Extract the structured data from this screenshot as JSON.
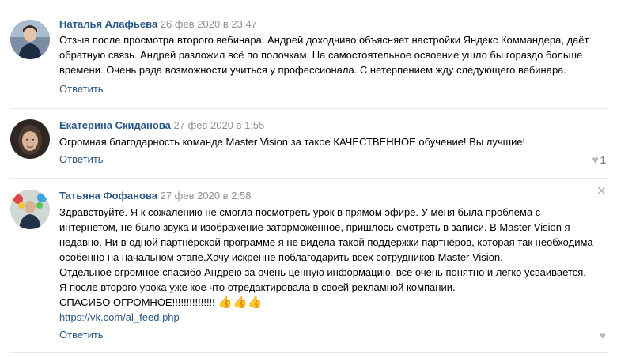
{
  "comments": [
    {
      "author": "Наталья Алафьева",
      "date": "26 фев 2020 в 23:47",
      "lines": [
        "Отзыв после просмотра второго вебинара. Андрей доходчиво объясняет настройки Яндекс Коммандера, даёт",
        "обратную связь. Андрей разложил всё по полочкам. На самостоятельное освоение ушло бы гораздо больше",
        "времени. Очень рада возможности учиться у профессионала. С нетерпением жду следующего вебинара."
      ],
      "reply_label": "Ответить"
    },
    {
      "author": "Екатерина Скиданова",
      "date": "27 фев 2020 в 1:55",
      "lines": [
        "Огромная благодарность команде Master Vision за такое КАЧЕСТВЕННОЕ обучение! Вы лучшие!"
      ],
      "reply_label": "Ответить",
      "likes": "1"
    },
    {
      "author": "Татьяна Фофанова",
      "date": "27 фев 2020 в 2:58",
      "lines": [
        "Здравствуйте. Я к сожалению не смогла посмотреть урок в прямом эфире. У меня была проблема с",
        "интернетом, не было звука и изображение заторможенное, пришлось смотреть в записи. В Master Vision я",
        "недавно. Ни в одной партнёрской программе я не видела такой поддержки партнёров, которая так необходима",
        "особенно на начальном этапе.Хочу искренне поблагодарить всех сотрудников Master Vision.",
        "Отдельное огромное спасибо Андрею за очень ценную информацию, всё очень понятно и легко усваивается.",
        "Я после второго урока уже кое что отредактировала в своей рекламной компании.",
        "СПАСИБО ОГРОМНОЕ!!!!!!!!!!!!!!!"
      ],
      "emoji": "👍👍👍",
      "link": "https://vk.com/al_feed.php",
      "reply_label": "Ответить",
      "close_symbol": "✕"
    }
  ]
}
